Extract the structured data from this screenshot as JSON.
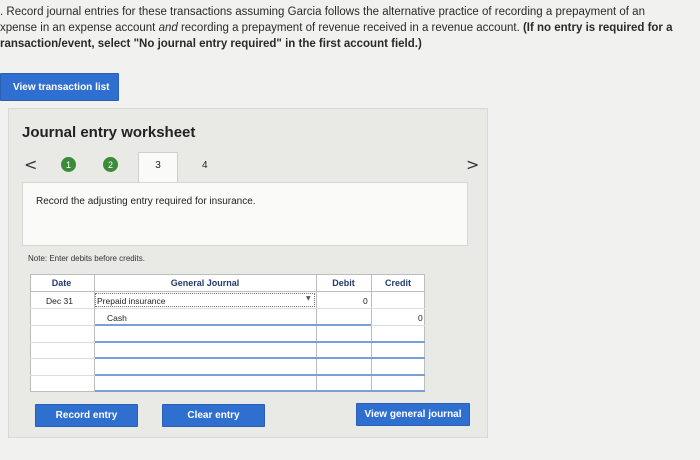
{
  "instructions": {
    "line1": ". Record journal entries for these transactions assuming Garcia follows the alternative practice of recording a prepayment of an",
    "line2_a": "xpense in an expense account ",
    "line2_em": "and",
    "line2_b": " recording a prepayment of revenue received in a revenue account. ",
    "line2_bold": "(If no entry is required for a",
    "line3_bold": "ransaction/event, select \"No journal entry required\" in the first account field.)"
  },
  "view_transaction_button": "View transaction list",
  "worksheet": {
    "title": "Journal entry worksheet",
    "nav_prev": "<",
    "nav_next": ">",
    "steps": [
      "1",
      "2",
      "3",
      "4"
    ],
    "active_step": "3",
    "prompt": "Record the adjusting entry required for insurance.",
    "note": "Note: Enter debits before credits."
  },
  "journal": {
    "headers": {
      "date": "Date",
      "general_journal": "General Journal",
      "debit": "Debit",
      "credit": "Credit"
    },
    "rows": [
      {
        "date": "Dec 31",
        "account": "Prepaid insurance",
        "debit": "0",
        "credit": ""
      },
      {
        "date": "",
        "account": "Cash",
        "debit": "",
        "credit": "0"
      },
      {
        "date": "",
        "account": "",
        "debit": "",
        "credit": ""
      },
      {
        "date": "",
        "account": "",
        "debit": "",
        "credit": ""
      },
      {
        "date": "",
        "account": "",
        "debit": "",
        "credit": ""
      },
      {
        "date": "",
        "account": "",
        "debit": "",
        "credit": ""
      }
    ]
  },
  "buttons": {
    "record": "Record entry",
    "clear": "Clear entry",
    "view_general": "View general journal"
  },
  "colors": {
    "button_blue": "#2f6fd0",
    "step_green": "#3a8b3a",
    "header_navy": "#223a6e"
  }
}
